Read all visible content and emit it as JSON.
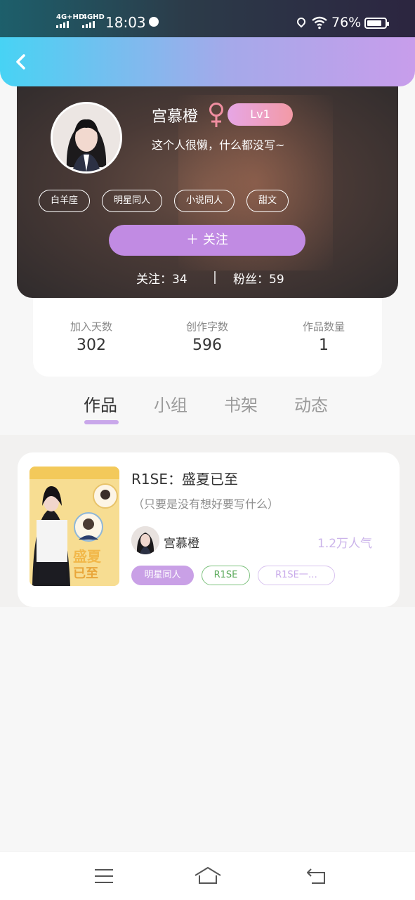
{
  "status_bar": {
    "network_1": "4G+HD",
    "network_2": "4GHD",
    "time": "18:03",
    "battery": "76%",
    "icons": [
      "signal-icon",
      "globe-icon",
      "location-icon",
      "wifi-icon",
      "battery-icon"
    ],
    "battery_level": 0.76
  },
  "header": {
    "back_icon": "chevron-left-icon",
    "gradient": [
      "#47d3f4",
      "#c89deb"
    ]
  },
  "profile": {
    "username": "宫慕橙",
    "gender_icon": "female-icon",
    "level": "Lv1",
    "bio": "这个人很懒，什么都没写~",
    "tags": [
      "白羊座",
      "明星同人",
      "小说同人",
      "甜文"
    ],
    "follow_button": "＋  关注",
    "following_label": "关注：34",
    "fans_label": "粉丝：59"
  },
  "stats": [
    {
      "label": "加入天数",
      "value": "302"
    },
    {
      "label": "创作字数",
      "value": "596"
    },
    {
      "label": "作品数量",
      "value": "1"
    }
  ],
  "tabs": [
    {
      "label": "作品",
      "active": true
    },
    {
      "label": "小组",
      "active": false
    },
    {
      "label": "书架",
      "active": false
    },
    {
      "label": "动态",
      "active": false
    }
  ],
  "works": [
    {
      "title": "R1SE：盛夏已至",
      "description": "（只要是没有想好要写什么）",
      "author": "宫慕橙",
      "popularity": "1.2万人气",
      "tags": [
        "明星同人",
        "R1SE",
        "R1SE一…"
      ]
    }
  ],
  "nav_bar": {
    "icons": [
      "menu-icon",
      "home-icon",
      "back-icon"
    ]
  },
  "colors": {
    "accent_purple": "#c18be3",
    "level_badge": "#f39aa6",
    "popularity": "#cbb4ea",
    "tag_green": "#7ec27e"
  }
}
